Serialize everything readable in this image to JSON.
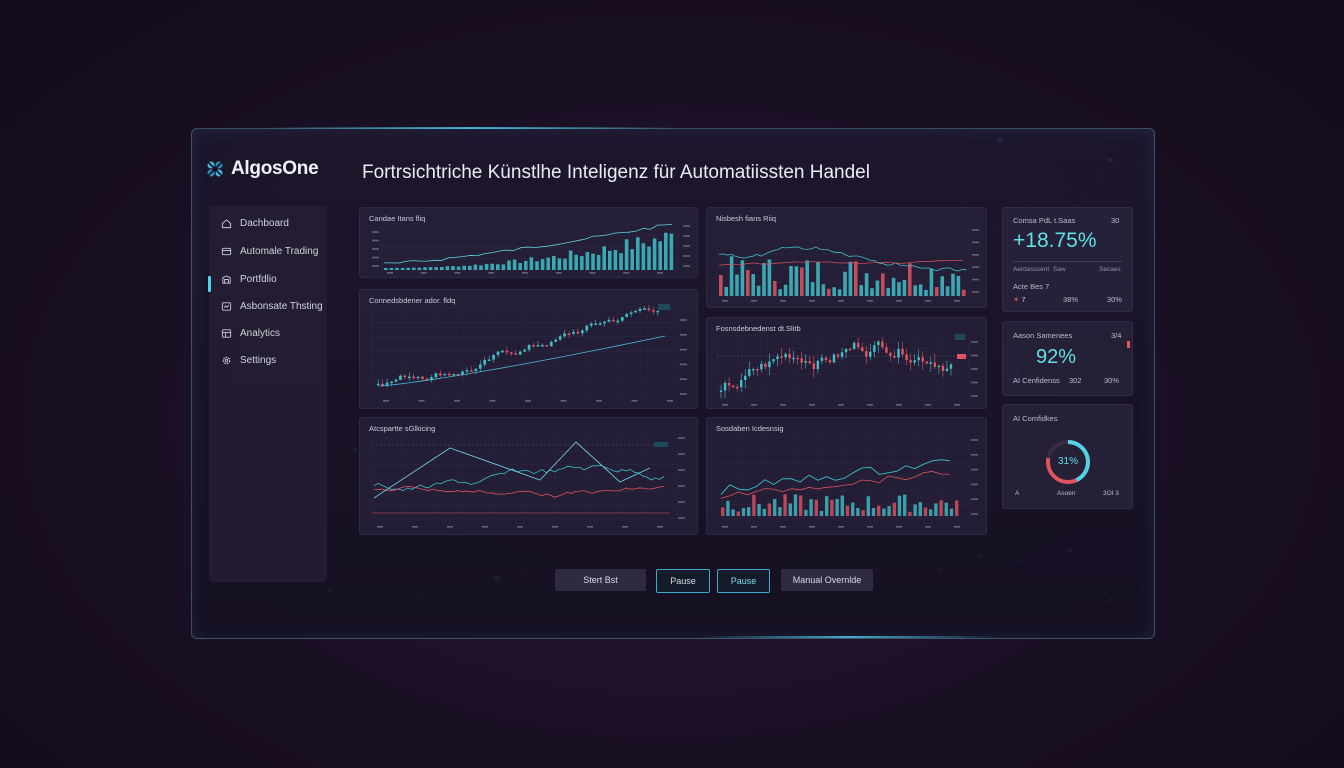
{
  "app": {
    "name": "AlgosOne",
    "title": "Fortrsichtriche Künstlhe Inteligenz für Automatiissten Handel"
  },
  "sidebar": {
    "items": [
      {
        "label": "Dachboard",
        "icon": "home-icon"
      },
      {
        "label": "Automale Trading",
        "icon": "trading-icon"
      },
      {
        "label": "Portfdlio",
        "icon": "portfolio-icon"
      },
      {
        "label": "Asbonsate Thsting",
        "icon": "testing-icon"
      },
      {
        "label": "Analytics",
        "icon": "analytics-icon"
      },
      {
        "label": "Settings",
        "icon": "gear-icon"
      }
    ]
  },
  "panels": {
    "p1": {
      "title": "Candae Itans fliq"
    },
    "p2": {
      "title": "Nisbesh fians Riiq"
    },
    "p3": {
      "title": "Connedsbdener ador. fldq",
      "badge": "Hjh"
    },
    "p4": {
      "title": "Fosnsdebnedenst dt.Slitb",
      "badge": "Hj"
    },
    "p5": {
      "title": "Atcspartte sGlkicing"
    },
    "p6": {
      "title": "Sosdaben Icdesnsig"
    }
  },
  "stats": {
    "pl": {
      "label": "Comsa PdL t.Saas",
      "corner": "30",
      "value": "+18.75%",
      "sub_left": "Aerdasssent",
      "sub_mid": "Saw",
      "sub_right": "Secaes",
      "row_label": "Acte Bes 7",
      "row_a": "7",
      "row_b": "38%",
      "row_c": "30%"
    },
    "sentiment": {
      "label": "Aason Samenees",
      "corner": "3/4",
      "value": "92%",
      "row_label": "AI Cenfidenss",
      "row_mid": "302",
      "row_right": "30%"
    },
    "confidence": {
      "label": "AI Comfidkes",
      "gauge_value": "31%",
      "gauge_fraction": 0.78,
      "foot_left": "A",
      "foot_mid": "Asoen",
      "foot_right": "3OI 3"
    }
  },
  "buttons": {
    "start": "Stert Bst",
    "pause1": "Pause",
    "pause2": "Pause",
    "override": "Manual Overnlde"
  },
  "colors": {
    "accent": "#4fd3e6",
    "bull": "#3fc0c8",
    "bear": "#e0535f",
    "background": "#1a1024"
  }
}
